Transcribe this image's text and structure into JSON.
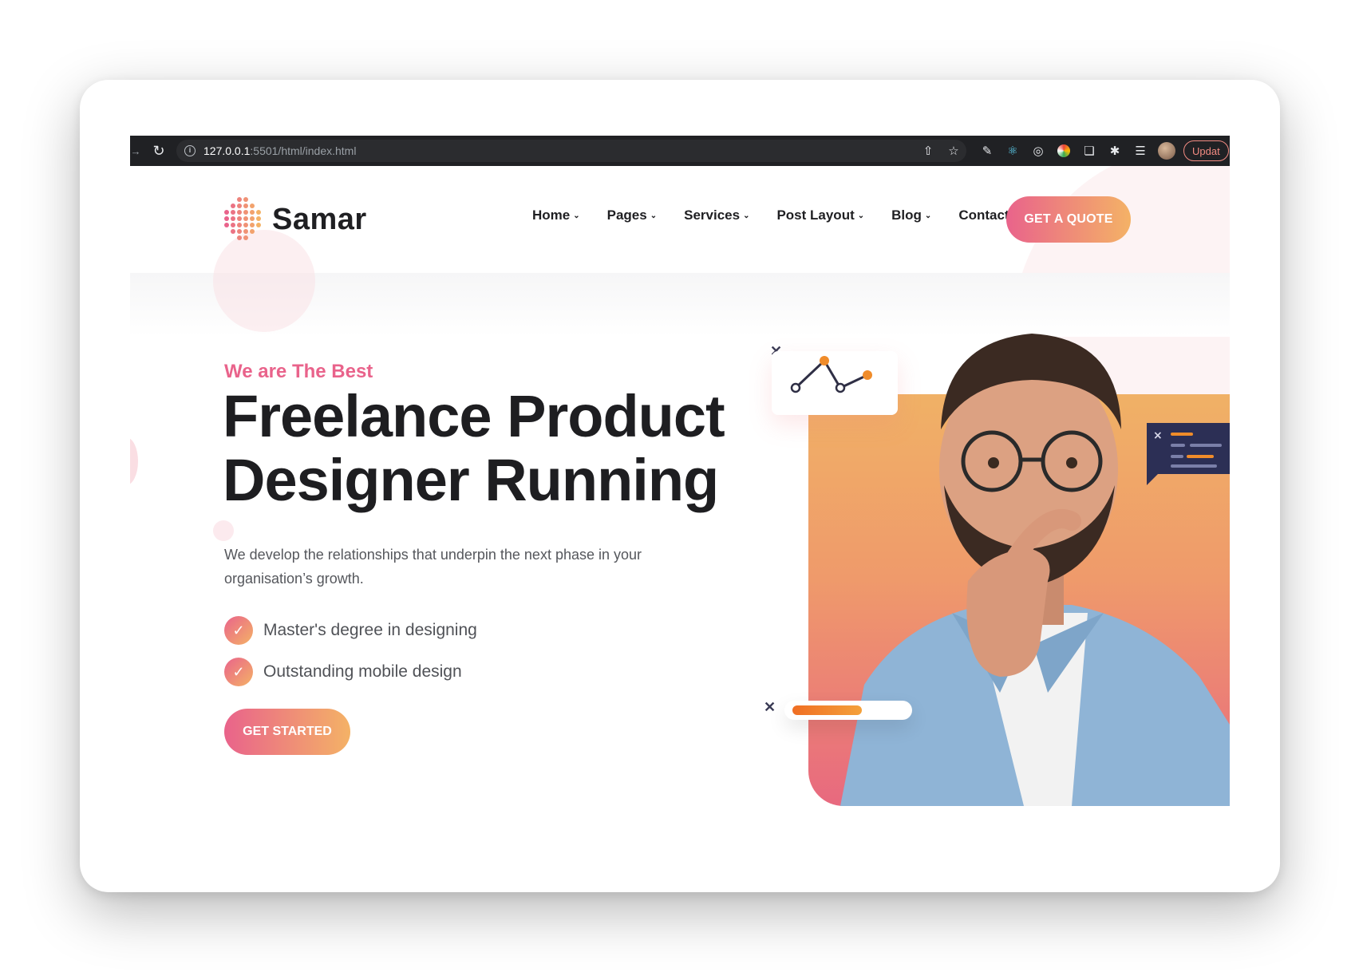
{
  "browser": {
    "url_host": "127.0.0.1",
    "url_path": ":5501/html/index.html",
    "update_label": "Updat"
  },
  "site": {
    "logo_text": "Samar",
    "nav": [
      {
        "label": "Home"
      },
      {
        "label": "Pages"
      },
      {
        "label": "Services"
      },
      {
        "label": "Post Layout"
      },
      {
        "label": "Blog"
      },
      {
        "label": "Contact Us"
      }
    ],
    "quote_label": "GET A QUOTE"
  },
  "hero": {
    "eyebrow": "We are The Best",
    "title_line1": "Freelance Product",
    "title_line2": "Designer Running",
    "description": "We develop the relationships that underpin the next phase in your organisation’s growth.",
    "checks": [
      {
        "label": "Master's degree in designing"
      },
      {
        "label": "Outstanding mobile design"
      }
    ],
    "cta_label": "GET STARTED",
    "progress_value": 0.62
  },
  "colors": {
    "accent_pink": "#e9638b",
    "accent_orange": "#f4b266",
    "toolbar_bg": "#202124"
  },
  "icons": {
    "reload": "reload-icon",
    "info": "info-icon",
    "share": "share-icon",
    "star": "bookmark-star-icon",
    "extensions": "puzzle-icon"
  }
}
